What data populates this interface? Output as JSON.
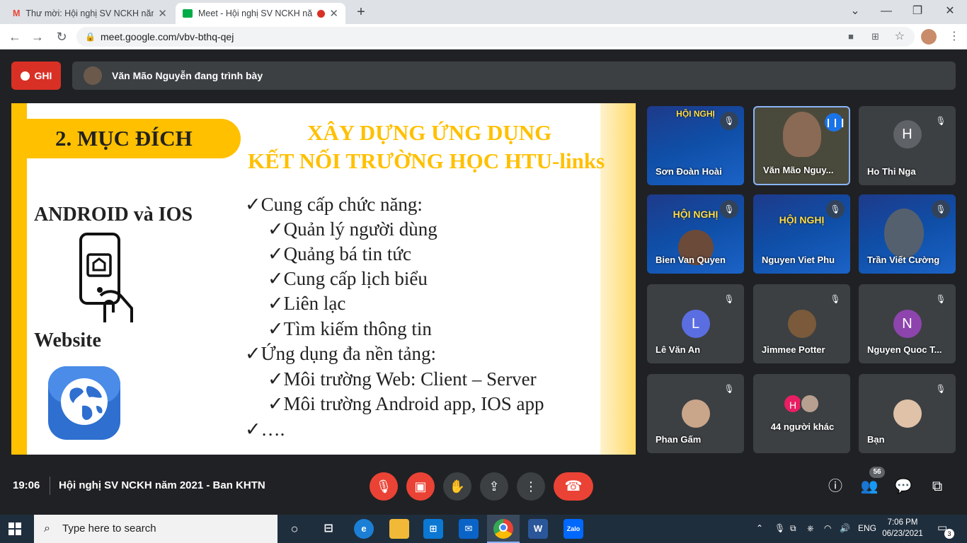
{
  "browser": {
    "tabs": [
      {
        "title": "Thư mời: Hội nghị SV NCKH năm",
        "close": "✕"
      },
      {
        "title": "Meet - Hội nghị SV NCKH nă",
        "close": "✕"
      }
    ],
    "new_tab": "+",
    "address": "meet.google.com/vbv-bthq-qej"
  },
  "meet": {
    "record_label": "GHI",
    "presenting_text": "Văn Mão Nguyễn đang trình bày",
    "meeting_time": "19:06",
    "meeting_title": "Hội nghị SV NCKH năm 2021 - Ban KHTN",
    "participants_count": "56"
  },
  "slide": {
    "section": "2. MỤC ĐÍCH",
    "title_line1": "XÂY DỰNG ỨNG DỤNG",
    "title_line2": "KẾT NỐI TRƯỜNG HỌC HTU-links",
    "platform_mobile": "ANDROID và IOS",
    "platform_web": "Website",
    "bullets": [
      "✓Cung cấp chức năng:",
      "✓Quản lý người dùng",
      "✓Quảng bá tin tức",
      "✓Cung cấp lịch biểu",
      "✓Liên lạc",
      "✓Tìm kiếm thông tin",
      "✓Ứng dụng đa nền tảng:",
      "✓Môi trường Web: Client – Server",
      "✓Môi trường Android app, IOS app",
      "✓…."
    ]
  },
  "participants": [
    {
      "name": "Sơn Đoàn Hoài",
      "banner": "HỘI NGHỊ"
    },
    {
      "name": "Văn Mão Nguy..."
    },
    {
      "name": "Ho Thi Nga",
      "initial": "H"
    },
    {
      "name": "Bien Van Quyen",
      "banner": "HỘI NGHỊ"
    },
    {
      "name": "Nguyen Viet Phu",
      "banner": "HỘI NGHỊ"
    },
    {
      "name": "Trần Viết Cường"
    },
    {
      "name": "Lê Văn An",
      "initial": "L"
    },
    {
      "name": "Jimmee Potter"
    },
    {
      "name": "Nguyen Quoc T...",
      "initial": "N"
    },
    {
      "name": "Phan Gấm"
    },
    {
      "name": "44 người khác",
      "initial": "H"
    },
    {
      "name": "Bạn"
    }
  ],
  "colors": {
    "avatar_blue": "#5b6ee1",
    "avatar_purple": "#8e44ad",
    "record_red": "#d93025",
    "accent": "#ffc000"
  },
  "taskbar": {
    "search_placeholder": "Type here to search",
    "language": "ENG",
    "time": "7:06 PM",
    "date": "06/23/2021",
    "notifications": "3",
    "zalo": "Zalo",
    "word": "W"
  }
}
